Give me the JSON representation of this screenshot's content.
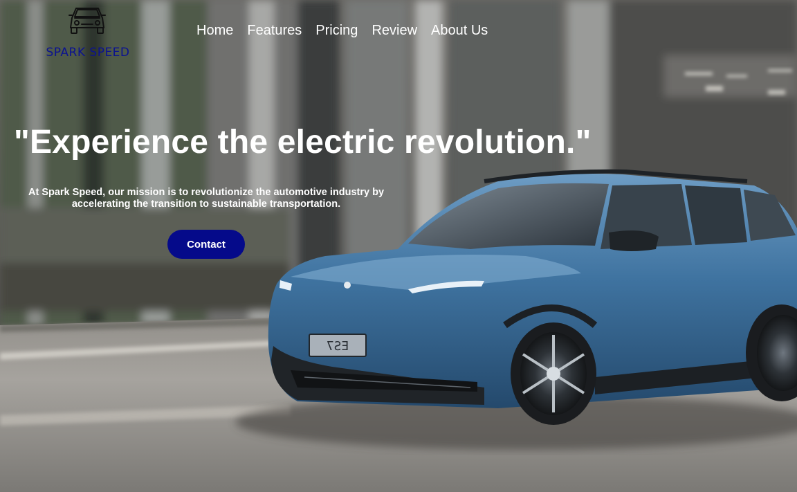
{
  "brand": {
    "name": "SPARK SPEED",
    "logo_icon": "car-front-icon"
  },
  "nav": {
    "items": [
      {
        "label": "Home"
      },
      {
        "label": "Features"
      },
      {
        "label": "Pricing"
      },
      {
        "label": "Review"
      },
      {
        "label": "About Us"
      }
    ]
  },
  "hero": {
    "headline": "\"Experience the electric revolution.\"",
    "mission": "At Spark Speed, our mission is to revolutionize the automotive industry by accelerating the transition to sustainable transportation.",
    "cta_label": "Contact",
    "license_plate": "ES7"
  },
  "colors": {
    "brand_text": "#0b1290",
    "cta_background": "#050a8a",
    "car_body": "#3d6f99",
    "nav_text": "#ffffff"
  }
}
